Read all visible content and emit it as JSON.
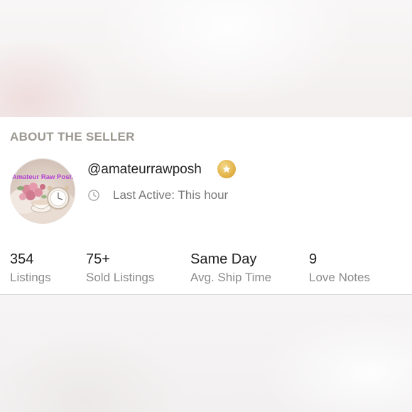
{
  "section": {
    "title": "ABOUT THE SELLER"
  },
  "seller": {
    "avatar_text": "Amateur Raw Posh",
    "username": "@amateurrawposh",
    "badge_icon": "star-icon",
    "badge_color": "#d9a63c",
    "last_active": "Last Active: This hour"
  },
  "stats": [
    {
      "value": "354",
      "label": "Listings"
    },
    {
      "value": "75+",
      "label": "Sold Listings"
    },
    {
      "value": "Same Day",
      "label": "Avg. Ship Time"
    },
    {
      "value": "9",
      "label": "Love Notes"
    }
  ]
}
